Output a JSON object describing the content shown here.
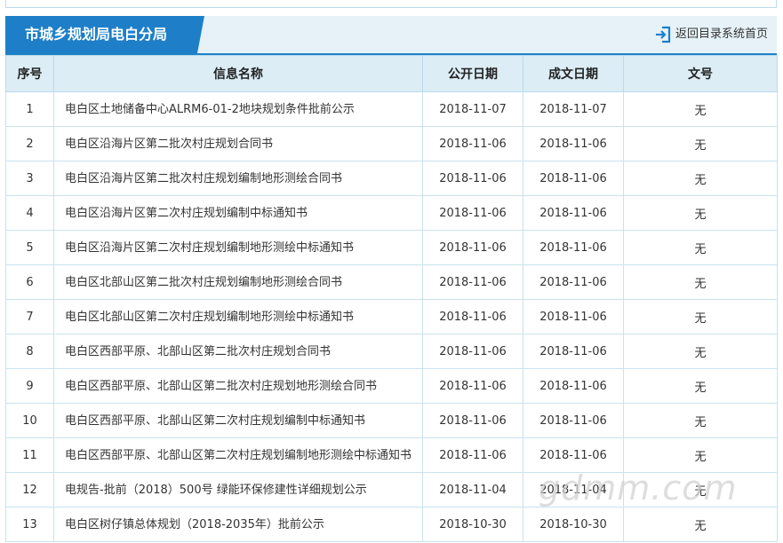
{
  "header": {
    "title": "市城乡规划局电白分局",
    "home_link": "返回目录系统首页"
  },
  "table": {
    "columns": [
      "序号",
      "信息名称",
      "公开日期",
      "成文日期",
      "文号"
    ],
    "rows": [
      {
        "no": "1",
        "name": "电白区土地储备中心ALRM6-01-2地块规划条件批前公示",
        "open_date": "2018-11-07",
        "doc_date": "2018-11-07",
        "doc_no": "无"
      },
      {
        "no": "2",
        "name": "电白区沿海片区第二批次村庄规划合同书",
        "open_date": "2018-11-06",
        "doc_date": "2018-11-06",
        "doc_no": "无"
      },
      {
        "no": "3",
        "name": "电白区沿海片区第二批次村庄规划编制地形测绘合同书",
        "open_date": "2018-11-06",
        "doc_date": "2018-11-06",
        "doc_no": "无"
      },
      {
        "no": "4",
        "name": "电白区沿海片区第二次村庄规划编制中标通知书",
        "open_date": "2018-11-06",
        "doc_date": "2018-11-06",
        "doc_no": "无"
      },
      {
        "no": "5",
        "name": "电白区沿海片区第二次村庄规划编制地形测绘中标通知书",
        "open_date": "2018-11-06",
        "doc_date": "2018-11-06",
        "doc_no": "无"
      },
      {
        "no": "6",
        "name": "电白区北部山区第二批次村庄规划编制地形测绘合同书",
        "open_date": "2018-11-06",
        "doc_date": "2018-11-06",
        "doc_no": "无"
      },
      {
        "no": "7",
        "name": "电白区北部山区第二次村庄规划编制地形测绘中标通知书",
        "open_date": "2018-11-06",
        "doc_date": "2018-11-06",
        "doc_no": "无"
      },
      {
        "no": "8",
        "name": "电白区西部平原、北部山区第二批次村庄规划合同书",
        "open_date": "2018-11-06",
        "doc_date": "2018-11-06",
        "doc_no": "无"
      },
      {
        "no": "9",
        "name": "电白区西部平原、北部山区第二批次村庄规划地形测绘合同书",
        "open_date": "2018-11-06",
        "doc_date": "2018-11-06",
        "doc_no": "无"
      },
      {
        "no": "10",
        "name": "电白区西部平原、北部山区第二次村庄规划编制中标通知书",
        "open_date": "2018-11-06",
        "doc_date": "2018-11-06",
        "doc_no": "无"
      },
      {
        "no": "11",
        "name": "电白区西部平原、北部山区第二次村庄规划编制地形测绘中标通知书",
        "open_date": "2018-11-06",
        "doc_date": "2018-11-06",
        "doc_no": "无"
      },
      {
        "no": "12",
        "name": "电规告-批前（2018）500号 绿能环保修建性详细规划公示",
        "open_date": "2018-11-04",
        "doc_date": "2018-11-04",
        "doc_no": "无"
      },
      {
        "no": "13",
        "name": "电白区树仔镇总体规划（2018-2035年）批前公示",
        "open_date": "2018-10-30",
        "doc_date": "2018-10-30",
        "doc_no": "无"
      }
    ]
  },
  "watermark": "gdmm.com",
  "colors": {
    "accent": "#1e7fc8",
    "header_bg": "#e6f2f8",
    "table_head_bg": "#dcedf6",
    "border": "#c9e3ef"
  },
  "icons": {
    "home_link": "login-arrow-icon"
  }
}
